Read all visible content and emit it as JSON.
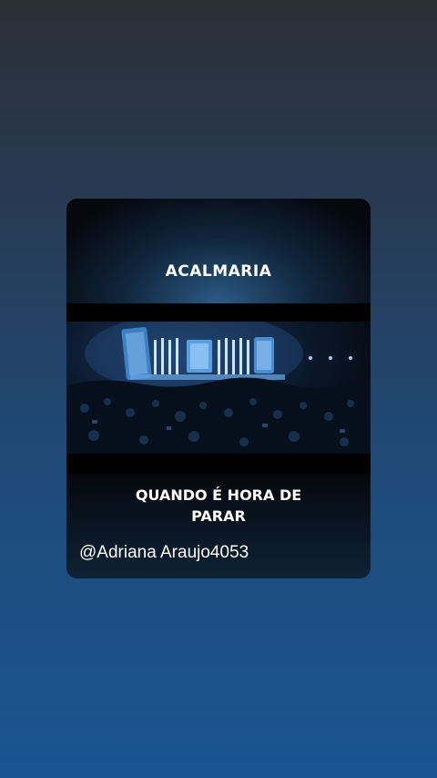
{
  "card": {
    "title": "ACALMARIA",
    "caption_line1": "QUANDO É HORA DE",
    "caption_line2": "PARAR",
    "handle": "@Adriana Araujo4053"
  },
  "video": {
    "scene": "concert-stage-with-crowd-image"
  },
  "colors": {
    "background_top": "#2b2f36",
    "background_bottom": "#1a5592",
    "card": "#05080d",
    "text": "#ffffff"
  }
}
